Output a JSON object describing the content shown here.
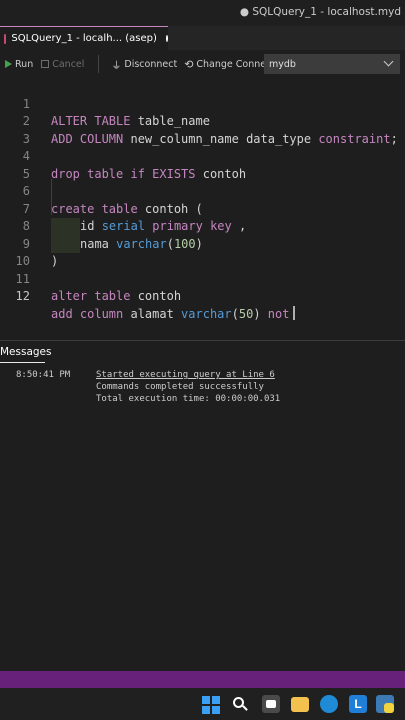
{
  "window": {
    "title": "● SQLQuery_1 - localhost.myd"
  },
  "tab": {
    "label": "SQLQuery_1 - localh... (asep)"
  },
  "toolbar": {
    "run_label": "Run",
    "cancel_label": "Cancel",
    "disconnect_label": "Disconnect",
    "change_connection_label": "Change Connection",
    "database_selected": "mydb"
  },
  "editor": {
    "line_numbers": [
      "1",
      "2",
      "3",
      "4",
      "5",
      "6",
      "7",
      "8",
      "9",
      "10",
      "11",
      "12"
    ],
    "active_line": 12,
    "lines": {
      "l1": {
        "kw1": "ALTER TABLE",
        "rest": " table_name"
      },
      "l2": {
        "kw1": "ADD COLUMN",
        "mid": " new_column_name data_type ",
        "kw2": "constraint",
        "end": ";"
      },
      "l4": {
        "kw1": "drop table if",
        "kw2": " EXISTS",
        "rest": " contoh"
      },
      "l6": {
        "kw1": "create table",
        "rest": " contoh ("
      },
      "l7": {
        "name": "id ",
        "ty": "serial",
        "kw": " primary key",
        "rest": " ,"
      },
      "l8": {
        "name": "nama ",
        "ty": "varchar",
        "open": "(",
        "num": "100",
        "close": ")"
      },
      "l9": {
        "rest": ")"
      },
      "l11": {
        "kw1": "alter table",
        "rest": " contoh"
      },
      "l12": {
        "kw1": "add column",
        "mid": " alamat ",
        "ty": "varchar",
        "open": "(",
        "num": "50",
        "close": ")",
        "kw2": " not"
      }
    }
  },
  "messages": {
    "header": "Messages",
    "time": "8:50:41 PM",
    "line1": "Started executing query at Line 6",
    "line2": "Commands completed successfully",
    "line3": "Total execution time: 00:00:00.031"
  },
  "colors": {
    "keyword": "#c586c0",
    "type": "#569cd6",
    "number": "#b5cea8",
    "statusbar": "#68217a"
  },
  "icons": {
    "run": "play-icon",
    "cancel": "stop-icon",
    "disconnect": "plug-icon",
    "change_connection": "sync-icon",
    "select": "chevron-down-icon"
  }
}
